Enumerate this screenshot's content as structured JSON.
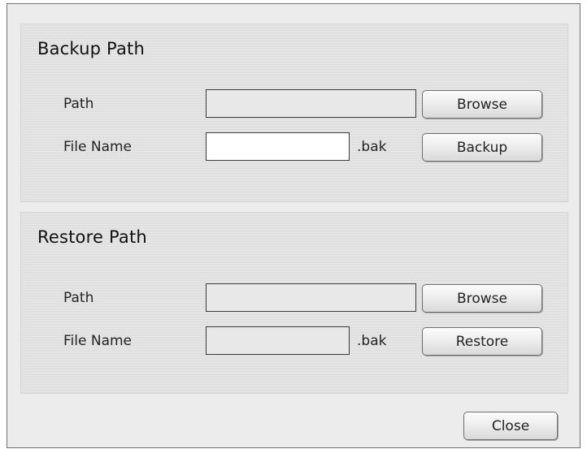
{
  "backup": {
    "title": "Backup Path",
    "path_label": "Path",
    "path_value": "",
    "browse_label": "Browse",
    "filename_label": "File Name",
    "filename_value": "",
    "extension": ".bak",
    "action_label": "Backup"
  },
  "restore": {
    "title": "Restore Path",
    "path_label": "Path",
    "path_value": "",
    "browse_label": "Browse",
    "filename_label": "File Name",
    "filename_value": "",
    "extension": ".bak",
    "action_label": "Restore"
  },
  "footer": {
    "close_label": "Close"
  }
}
